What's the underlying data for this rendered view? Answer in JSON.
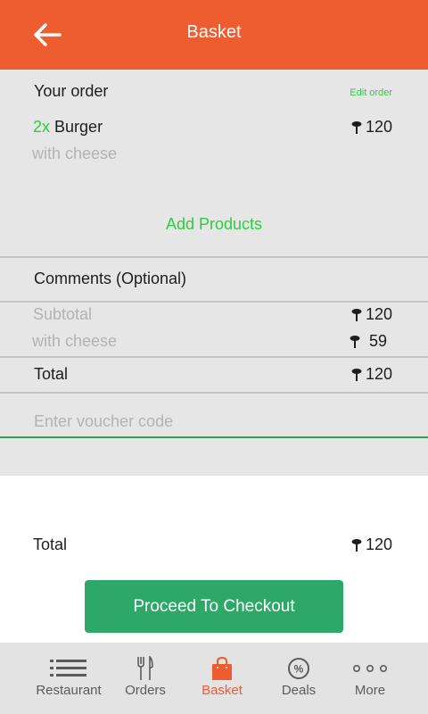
{
  "header": {
    "title": "Basket"
  },
  "order": {
    "heading": "Your order",
    "edit_label": "Edit order",
    "item_qty": "2x",
    "item_name": "Burger",
    "item_option": "with cheese",
    "item_price": "120",
    "add_products": "Add Products"
  },
  "comments": {
    "label": "Comments (Optional)"
  },
  "summary": {
    "subtotal_label": "Subtotal",
    "subtotal_value": "120",
    "extra_label": "with cheese",
    "extra_value": "59",
    "total_label": "Total",
    "total_value": "120"
  },
  "voucher": {
    "placeholder": "Enter voucher code"
  },
  "footer": {
    "total_label": "Total",
    "total_value": "120",
    "checkout_label": "Proceed To Checkout"
  },
  "nav": {
    "items": [
      {
        "label": "Restaurant",
        "icon": "list-icon"
      },
      {
        "label": "Orders",
        "icon": "fork-knife-icon"
      },
      {
        "label": "Basket",
        "icon": "shopping-bag-icon"
      },
      {
        "label": "Deals",
        "icon": "percent-icon"
      },
      {
        "label": "More",
        "icon": "more-dots-icon"
      }
    ],
    "active": "Basket"
  },
  "colors": {
    "brand": "#ee5d2f",
    "accent_green": "#2ecc40",
    "button_green": "#2ea866"
  }
}
